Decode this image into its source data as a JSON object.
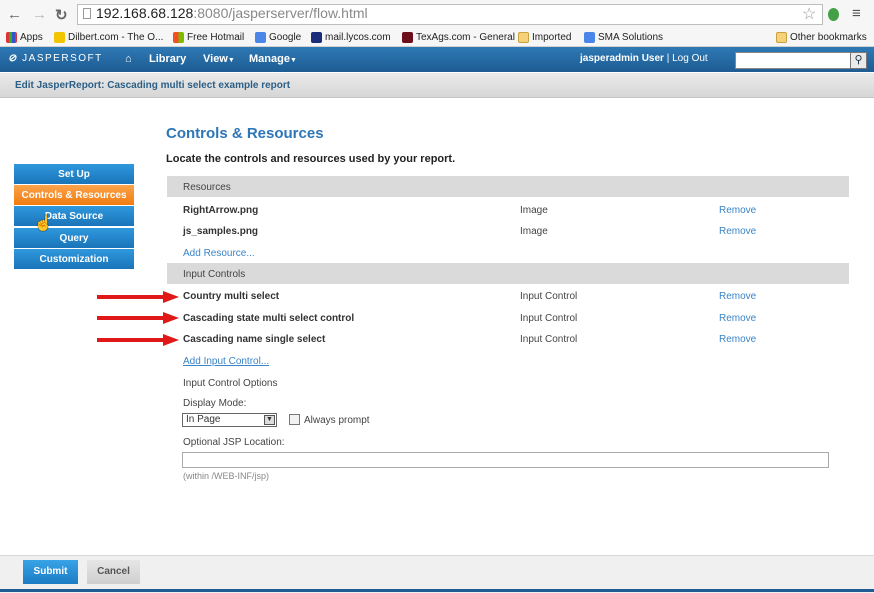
{
  "browser": {
    "url_host": "192.168.68.128",
    "url_path": ":8080/jasperserver/flow.html",
    "bookmarks": [
      "Apps",
      "Dilbert.com - The O...",
      "Free Hotmail",
      "Google",
      "mail.lycos.com",
      "TexAgs.com - General",
      "Imported",
      "SMA Solutions"
    ],
    "other_bookmarks": "Other bookmarks"
  },
  "header": {
    "logo": "JASPERSOFT",
    "menu": [
      "Library",
      "View",
      "Manage"
    ],
    "user": "jasperadmin User",
    "separator": "|",
    "logout": "Log Out"
  },
  "page": {
    "title": "Edit JasperReport: Cascading multi select example report"
  },
  "nav": {
    "items": [
      "Set Up",
      "Controls & Resources",
      "Data Source",
      "Query",
      "Customization"
    ],
    "active": "Controls & Resources"
  },
  "main": {
    "heading": "Controls & Resources",
    "subheading": "Locate the controls and resources used by your report.",
    "resources_header": "Resources",
    "resources": [
      {
        "name": "RightArrow.png",
        "type": "Image",
        "action": "Remove"
      },
      {
        "name": "js_samples.png",
        "type": "Image",
        "action": "Remove"
      }
    ],
    "add_resource": "Add Resource...",
    "controls_header": "Input Controls",
    "controls": [
      {
        "name": "Country multi select",
        "type": "Input Control",
        "action": "Remove"
      },
      {
        "name": "Cascading state multi select control",
        "type": "Input Control",
        "action": "Remove"
      },
      {
        "name": "Cascading name single select",
        "type": "Input Control",
        "action": "Remove"
      }
    ],
    "add_control": "Add Input Control...",
    "options_label": "Input Control Options",
    "display_mode_label": "Display Mode:",
    "display_mode_value": "In Page",
    "always_prompt": "Always prompt",
    "jsp_label": "Optional JSP Location:",
    "jsp_value": "",
    "jsp_hint": "(within /WEB-INF/jsp)"
  },
  "footer": {
    "submit": "Submit",
    "cancel": "Cancel"
  },
  "colors": {
    "header_blue": "#1e5c93",
    "nav_blue": "#1a74b9",
    "nav_active": "#f07c10",
    "link": "#3a84c7",
    "arrow_red": "#e01818"
  }
}
